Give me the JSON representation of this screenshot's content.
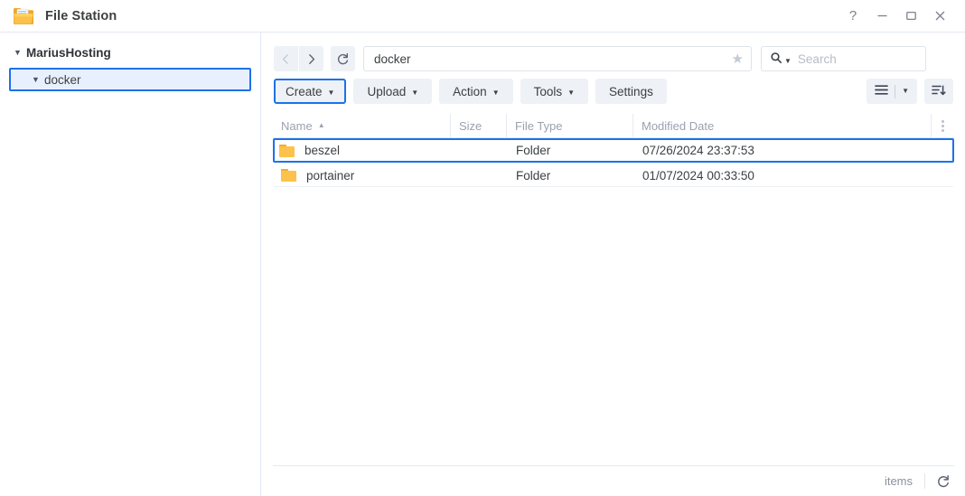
{
  "window": {
    "title": "File Station",
    "app_icon": "folder-app-icon",
    "controls": [
      {
        "name": "help-button",
        "glyph": "?"
      },
      {
        "name": "minimize-button",
        "glyph": "minimize-icon"
      },
      {
        "name": "maximize-button",
        "glyph": "maximize-icon"
      },
      {
        "name": "close-button",
        "glyph": "close-icon"
      }
    ]
  },
  "sidebar": {
    "root": {
      "label": "MariusHosting",
      "caret": "caret-down-icon"
    },
    "children": [
      {
        "label": "docker",
        "caret": "caret-down-icon",
        "selected": true
      }
    ]
  },
  "toolbar": {
    "nav": {
      "back": "back-arrow-icon",
      "forward": "forward-arrow-icon",
      "refresh": "refresh-icon"
    },
    "path": {
      "value": "docker",
      "favorite_icon": "star-icon"
    },
    "search": {
      "placeholder": "Search",
      "icon": "search-icon",
      "dropdown_icon": "caret-down-icon"
    },
    "buttons": [
      {
        "label": "Create",
        "caret": "▾",
        "focused": true
      },
      {
        "label": "Upload",
        "caret": "▾",
        "focused": false
      },
      {
        "label": "Action",
        "caret": "▾",
        "focused": false
      },
      {
        "label": "Tools",
        "caret": "▾",
        "focused": false
      },
      {
        "label": "Settings",
        "caret": "",
        "focused": false
      }
    ],
    "view_button": {
      "name": "list-view-button",
      "icon": "list-view-icon",
      "caret": "▾"
    },
    "sort_button": {
      "name": "sort-button",
      "icon": "sort-descending-icon"
    }
  },
  "file_list": {
    "columns": [
      {
        "key": "name",
        "label": "Name",
        "sorted": true,
        "sort_arrow": "▴"
      },
      {
        "key": "size",
        "label": "Size"
      },
      {
        "key": "type",
        "label": "File Type"
      },
      {
        "key": "date",
        "label": "Modified Date"
      }
    ],
    "column_menu_icon": "kebab-menu-icon",
    "rows": [
      {
        "icon": "folder-icon",
        "name": "beszel",
        "size": "",
        "type": "Folder",
        "date": "07/26/2024 23:37:53",
        "selected": true
      },
      {
        "icon": "folder-icon",
        "name": "portainer",
        "size": "",
        "type": "Folder",
        "date": "01/07/2024 00:33:50",
        "selected": false
      }
    ]
  },
  "statusbar": {
    "items_label": "items",
    "refresh_icon": "refresh-icon"
  },
  "colors": {
    "accent": "#1a73e8",
    "selection_fill": "#e8f0fe",
    "button_bg": "#eef1f6",
    "folder": "#fcc24b",
    "muted_text": "#9aa2ae"
  }
}
